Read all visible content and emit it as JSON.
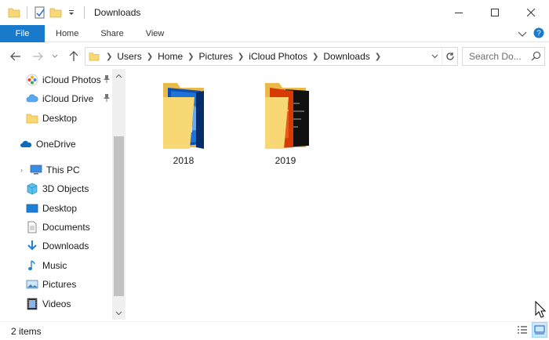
{
  "window": {
    "title": "Downloads"
  },
  "ribbon": {
    "file_label": "File",
    "tabs": [
      "Home",
      "Share",
      "View"
    ]
  },
  "address": {
    "crumbs": [
      "Users",
      "Home",
      "Pictures",
      "iCloud Photos",
      "Downloads"
    ]
  },
  "search": {
    "placeholder": "Search Do..."
  },
  "navpane": {
    "items": [
      {
        "label": "iCloud Photos",
        "icon": "icloud-photos-icon",
        "pinned": true
      },
      {
        "label": "iCloud Drive",
        "icon": "icloud-drive-icon",
        "pinned": true
      },
      {
        "label": "Desktop",
        "icon": "folder-icon",
        "pinned": false
      },
      {
        "label": "OneDrive",
        "icon": "onedrive-icon",
        "pinned": false
      },
      {
        "label": "This PC",
        "icon": "this-pc-icon",
        "pinned": false
      },
      {
        "label": "3D Objects",
        "icon": "3d-objects-icon",
        "pinned": false
      },
      {
        "label": "Desktop",
        "icon": "desktop-icon",
        "pinned": false
      },
      {
        "label": "Documents",
        "icon": "documents-icon",
        "pinned": false
      },
      {
        "label": "Downloads",
        "icon": "downloads-icon",
        "pinned": false
      },
      {
        "label": "Music",
        "icon": "music-icon",
        "pinned": false
      },
      {
        "label": "Pictures",
        "icon": "pictures-icon",
        "pinned": false
      },
      {
        "label": "Videos",
        "icon": "videos-icon",
        "pinned": false
      }
    ]
  },
  "files": [
    {
      "name": "2018"
    },
    {
      "name": "2019"
    }
  ],
  "status": {
    "item_count": "2 items"
  },
  "colors": {
    "accent": "#1979ca",
    "folder": "#f8d775",
    "folder_dark": "#e9b949"
  }
}
